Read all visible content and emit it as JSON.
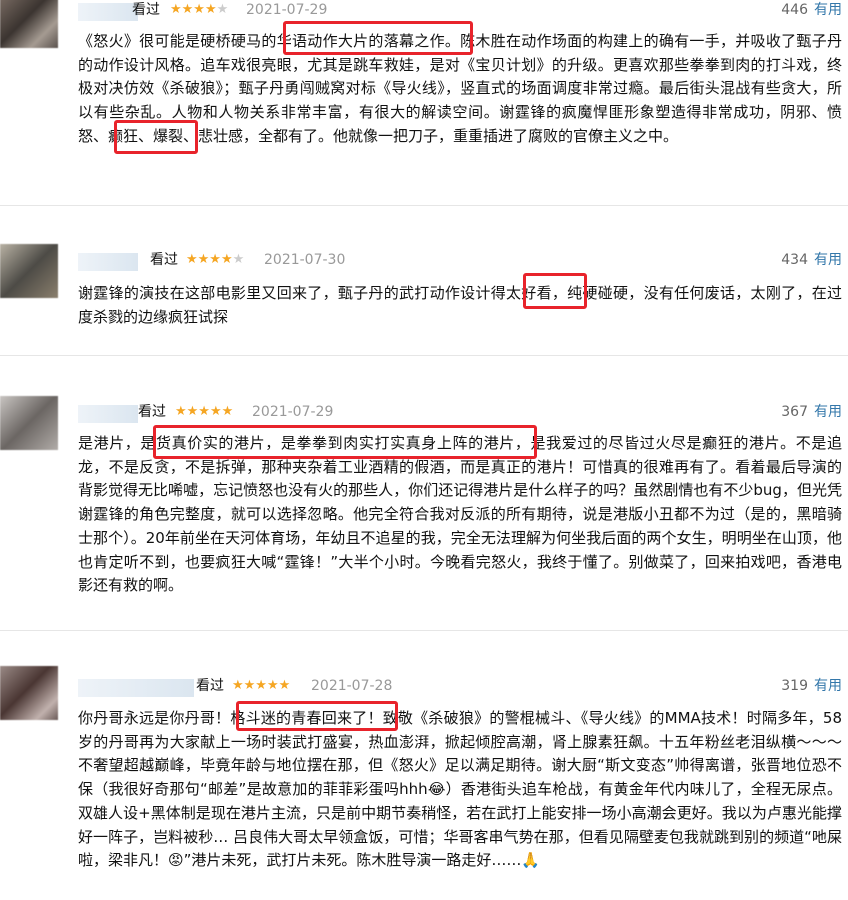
{
  "reviews": [
    {
      "seen": "看过",
      "stars": 4,
      "date": "2021-07-29",
      "votes": "446",
      "useful": "有用",
      "text": "《怒火》很可能是硬桥硬马的华语动作大片的落幕之作。陈木胜在动作场面的构建上的确有一手，并吸收了甄子丹的动作设计风格。追车戏很亮眼，尤其是跳车救娃，是对《宝贝计划》的升级。更喜欢那些拳拳到肉的打斗戏，终极对决仿效《杀破狼》；甄子丹勇闯贼窝对标《导火线》，竖直式的场面调度非常过瘾。最后街头混战有些贪大，所以有些杂乱。人物和人物关系非常丰富，有很大的解读空间。谢霆锋的疯魔悍匪形象塑造得非常成功，阴邪、愤怒、癫狂、爆裂、悲壮感，全都有了。他就像一把刀子，重重插进了腐败的官僚主义之中。"
    },
    {
      "seen": "看过",
      "stars": 4,
      "date": "2021-07-30",
      "votes": "434",
      "useful": "有用",
      "text": "谢霆锋的演技在这部电影里又回来了，甄子丹的武打动作设计得太好看，纯硬碰硬，没有任何废话，太刚了，在过度杀戮的边缘疯狂试探"
    },
    {
      "seen": "看过",
      "stars": 5,
      "date": "2021-07-29",
      "votes": "367",
      "useful": "有用",
      "text": "是港片，是货真价实的港片，是拳拳到肉实打实真身上阵的港片，是我爱过的尽皆过火尽是癫狂的港片。不是追龙，不是反贪，不是拆弹，那种夹杂着工业酒精的假酒，而是真正的港片！可惜真的很难再有了。看着最后导演的背影觉得无比唏嘘，忘记愤怒也没有火的那些人，你们还记得港片是什么样子的吗？虽然剧情也有不少bug，但光凭谢霆锋的角色完整度，就可以选择忽略。他完全符合我对反派的所有期待，说是港版小丑都不为过（是的，黑暗骑士那个）。20年前坐在天河体育场，年幼且不追星的我，完全无法理解为何坐我后面的两个女生，明明坐在山顶，他也肯定听不到，也要疯狂大喊“霆锋！”大半个小时。今晚看完怒火，我终于懂了。别做菜了，回来拍戏吧，香港电影还有救的啊。"
    },
    {
      "seen": "看过",
      "stars": 5,
      "date": "2021-07-28",
      "votes": "319",
      "useful": "有用",
      "text": "你丹哥永远是你丹哥！格斗迷的青春回来了！致敬《杀破狼》的警棍械斗、《导火线》的MMA技术！时隔多年，58岁的丹哥再为大家献上一场时装武打盛宴，热血澎湃，掀起倾腔高潮，肾上腺素狂飙。十五年粉丝老泪纵横～～～ 不奢望超越巅峰，毕竟年龄与地位摆在那，但《怒火》足以满足期待。谢大厨“斯文变态”帅得离谱，张晋地位恐不保（我很好奇那句“邮差”是故意加的菲菲彩蛋吗hhh😂）香港街头追车枪战，有黄金年代内味儿了，全程无尿点。双雄人设+黑体制是现在港片主流，只是前中期节奏稍怪，若在武打上能安排一场小高潮会更好。我以为卢惠光能撑好一阵子，岂料被秒… 吕良伟大哥太早领盒饭，可惜；华哥客串气势在那，但看见隔壁麦包我就跳到别的频道“吔屎啦，梁非凡！😡”港片未死，武打片未死。陈木胜导演一路走好……🙏"
    }
  ]
}
